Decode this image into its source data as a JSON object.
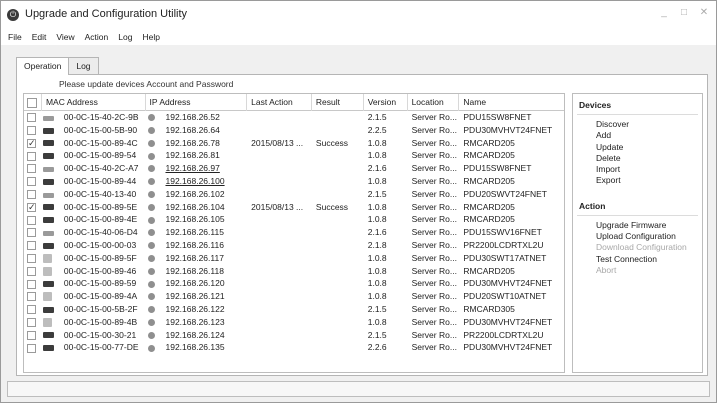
{
  "window": {
    "title": "Upgrade and Configuration Utility"
  },
  "menu": [
    "File",
    "Edit",
    "View",
    "Action",
    "Log",
    "Help"
  ],
  "tabs": [
    "Operation",
    "Log"
  ],
  "notice": "Please update devices Account and Password",
  "columns": {
    "mac": "MAC Address",
    "ip": "IP Address",
    "action": "Last Action",
    "result": "Result",
    "version": "Version",
    "location": "Location",
    "name": "Name"
  },
  "rows": [
    {
      "checked": false,
      "icon": "pdu",
      "mac": "00-0C-15-40-2C-9B",
      "ip": "192.168.26.52",
      "action": "",
      "result": "",
      "version": "2.1.5",
      "location": "Server Ro...",
      "name": "PDU15SW8FNET"
    },
    {
      "checked": false,
      "icon": "card",
      "mac": "00-0C-15-00-5B-90",
      "ip": "192.168.26.64",
      "action": "",
      "result": "",
      "version": "2.2.5",
      "location": "Server Ro...",
      "name": "PDU30MVHVT24FNET"
    },
    {
      "checked": true,
      "icon": "card",
      "mac": "00-0C-15-00-89-4C",
      "ip": "192.168.26.78",
      "action": "2015/08/13 ...",
      "result": "Success",
      "version": "1.0.8",
      "location": "Server Ro...",
      "name": "RMCARD205"
    },
    {
      "checked": false,
      "icon": "card",
      "mac": "00-0C-15-00-89-54",
      "ip": "192.168.26.81",
      "action": "",
      "result": "",
      "version": "1.0.8",
      "location": "Server Ro...",
      "name": "RMCARD205"
    },
    {
      "checked": false,
      "icon": "pdu",
      "mac": "00-0C-15-40-2C-A7",
      "ip": "192.168.26.97",
      "action": "",
      "result": "",
      "version": "2.1.6",
      "location": "Server Ro...",
      "name": "PDU15SW8FNET",
      "underline": true
    },
    {
      "checked": false,
      "icon": "card",
      "mac": "00-0C-15-00-89-44",
      "ip": "192.168.26.100",
      "action": "",
      "result": "",
      "version": "1.0.8",
      "location": "Server Ro...",
      "name": "RMCARD205",
      "underline": true
    },
    {
      "checked": false,
      "icon": "pdu",
      "mac": "00-0C-15-40-13-40",
      "ip": "192.168.26.102",
      "action": "",
      "result": "",
      "version": "2.1.5",
      "location": "Server Ro...",
      "name": "PDU20SWVT24FNET"
    },
    {
      "checked": true,
      "icon": "card",
      "mac": "00-0C-15-00-89-5E",
      "ip": "192.168.26.104",
      "action": "2015/08/13 ...",
      "result": "Success",
      "version": "1.0.8",
      "location": "Server Ro...",
      "name": "RMCARD205"
    },
    {
      "checked": false,
      "icon": "card",
      "mac": "00-0C-15-00-89-4E",
      "ip": "192.168.26.105",
      "action": "",
      "result": "",
      "version": "1.0.8",
      "location": "Server Ro...",
      "name": "RMCARD205"
    },
    {
      "checked": false,
      "icon": "pdu",
      "mac": "00-0C-15-40-06-D4",
      "ip": "192.168.26.115",
      "action": "",
      "result": "",
      "version": "2.1.6",
      "location": "Server Ro...",
      "name": "PDU15SWV16FNET"
    },
    {
      "checked": false,
      "icon": "card",
      "mac": "00-0C-15-00-00-03",
      "ip": "192.168.26.116",
      "action": "",
      "result": "",
      "version": "2.1.8",
      "location": "Server Ro...",
      "name": "PR2200LCDRTXL2U"
    },
    {
      "checked": false,
      "icon": "ups",
      "mac": "00-0C-15-00-89-5F",
      "ip": "192.168.26.117",
      "action": "",
      "result": "",
      "version": "1.0.8",
      "location": "Server Ro...",
      "name": "PDU30SWT17ATNET"
    },
    {
      "checked": false,
      "icon": "ups",
      "mac": "00-0C-15-00-89-46",
      "ip": "192.168.26.118",
      "action": "",
      "result": "",
      "version": "1.0.8",
      "location": "Server Ro...",
      "name": "RMCARD205"
    },
    {
      "checked": false,
      "icon": "card",
      "mac": "00-0C-15-00-89-59",
      "ip": "192.168.26.120",
      "action": "",
      "result": "",
      "version": "1.0.8",
      "location": "Server Ro...",
      "name": "PDU30MVHVT24FNET"
    },
    {
      "checked": false,
      "icon": "ups",
      "mac": "00-0C-15-00-89-4A",
      "ip": "192.168.26.121",
      "action": "",
      "result": "",
      "version": "1.0.8",
      "location": "Server Ro...",
      "name": "PDU20SWT10ATNET"
    },
    {
      "checked": false,
      "icon": "card",
      "mac": "00-0C-15-00-5B-2F",
      "ip": "192.168.26.122",
      "action": "",
      "result": "",
      "version": "2.1.5",
      "location": "Server Ro...",
      "name": "RMCARD305"
    },
    {
      "checked": false,
      "icon": "ups",
      "mac": "00-0C-15-00-89-4B",
      "ip": "192.168.26.123",
      "action": "",
      "result": "",
      "version": "1.0.8",
      "location": "Server Ro...",
      "name": "PDU30MVHVT24FNET"
    },
    {
      "checked": false,
      "icon": "card",
      "mac": "00-0C-15-00-30-21",
      "ip": "192.168.26.124",
      "action": "",
      "result": "",
      "version": "2.1.5",
      "location": "Server Ro...",
      "name": "PR2200LCDRTXL2U"
    },
    {
      "checked": false,
      "icon": "card",
      "mac": "00-0C-15-00-77-DE",
      "ip": "192.168.26.135",
      "action": "",
      "result": "",
      "version": "2.2.6",
      "location": "Server Ro...",
      "name": "PDU30MVHVT24FNET"
    }
  ],
  "devices_panel": {
    "title": "Devices",
    "items": [
      {
        "label": "Discover",
        "enabled": true
      },
      {
        "label": "Add",
        "enabled": true
      },
      {
        "label": "Update",
        "enabled": true
      },
      {
        "label": "Delete",
        "enabled": true
      },
      {
        "label": "Import",
        "enabled": true
      },
      {
        "label": "Export",
        "enabled": true
      }
    ]
  },
  "action_panel": {
    "title": "Action",
    "items": [
      {
        "label": "Upgrade Firmware",
        "enabled": true
      },
      {
        "label": "Upload Configuration",
        "enabled": true
      },
      {
        "label": "Download Configuration",
        "enabled": false
      },
      {
        "label": "Test Connection",
        "enabled": true
      },
      {
        "label": "Abort",
        "enabled": false
      }
    ]
  }
}
